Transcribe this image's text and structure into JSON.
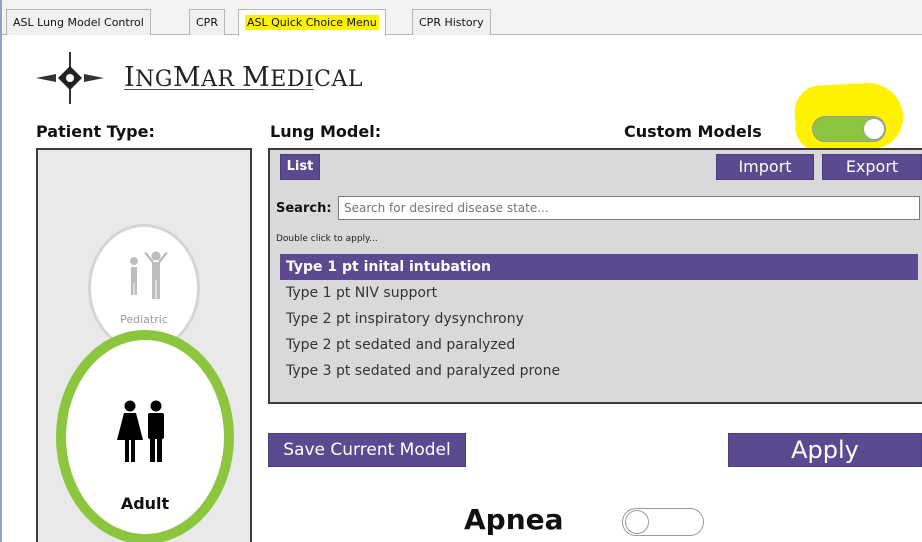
{
  "tabs": [
    {
      "label": "ASL Lung Model Control",
      "active": false,
      "highlighted": false
    },
    {
      "label": "CPR",
      "active": false,
      "highlighted": false
    },
    {
      "label": "ASL Quick Choice Menu",
      "active": true,
      "highlighted": true
    },
    {
      "label": "CPR History",
      "active": false,
      "highlighted": false
    }
  ],
  "brand": {
    "logo_first": "I",
    "logo_rest_1": "NG",
    "logo_mid": "M",
    "logo_rest_2": "AR ",
    "logo_second": "M",
    "logo_rest_3": "EDICAL",
    "logo_icon": "compass-diamond-icon"
  },
  "patient": {
    "heading": "Patient Type:",
    "pediatric_label": "Pediatric",
    "pediatric_icon": "child-adult-icon",
    "adult_label": "Adult",
    "adult_icon": "woman-man-icon",
    "selected": "Adult"
  },
  "lung": {
    "heading": "Lung Model:",
    "custom_models_label": "Custom Models",
    "custom_models_on": true,
    "list_tab": "List",
    "import_label": "Import",
    "export_label": "Export",
    "search_label": "Search:",
    "search_placeholder": "Search for desired disease state...",
    "hint": "Double click to apply...",
    "items": [
      {
        "label": "Type 1 pt inital intubation",
        "selected": true
      },
      {
        "label": "Type 1 pt NIV support",
        "selected": false
      },
      {
        "label": "Type 2 pt inspiratory dysynchrony",
        "selected": false
      },
      {
        "label": "Type 2 pt sedated and paralyzed",
        "selected": false
      },
      {
        "label": "Type 3 pt sedated and paralyzed prone",
        "selected": false
      }
    ]
  },
  "actions": {
    "save_label": "Save Current Model",
    "apply_label": "Apply"
  },
  "apnea": {
    "label": "Apnea",
    "on": false
  },
  "colors": {
    "accent_purple": "#5b4a8f",
    "toggle_green": "#8cc63f",
    "highlight_yellow": "#fff200",
    "panel_gray": "#d9d9d9"
  }
}
